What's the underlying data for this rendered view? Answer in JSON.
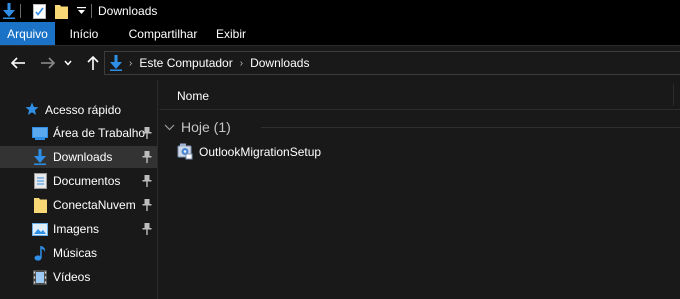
{
  "titlebar": {
    "title": "Downloads",
    "icons": [
      "downloads-folder-icon",
      "properties-icon",
      "new-folder-icon",
      "customize-toolbar-icon"
    ]
  },
  "ribbon": {
    "tabs": [
      {
        "label": "Arquivo",
        "active": true
      },
      {
        "label": "Início",
        "active": false
      },
      {
        "label": "Compartilhar",
        "active": false
      },
      {
        "label": "Exibir",
        "active": false
      }
    ]
  },
  "address": {
    "icons": [
      "back-arrow-icon",
      "forward-arrow-icon",
      "recent-locations-chevron-icon",
      "up-arrow-icon"
    ],
    "breadcrumbs": [
      "Este Computador",
      "Downloads"
    ]
  },
  "sidebar": {
    "quick_access": "Acesso rápido",
    "items": [
      {
        "label": "Área de Trabalho",
        "icon": "desktop-icon",
        "pinned": true,
        "selected": false
      },
      {
        "label": "Downloads",
        "icon": "downloads-icon",
        "pinned": true,
        "selected": true
      },
      {
        "label": "Documentos",
        "icon": "documents-icon",
        "pinned": true,
        "selected": false
      },
      {
        "label": "ConectaNuvem",
        "icon": "folder-icon",
        "pinned": true,
        "selected": false
      },
      {
        "label": "Imagens",
        "icon": "pictures-icon",
        "pinned": true,
        "selected": false
      },
      {
        "label": "Músicas",
        "icon": "music-icon",
        "pinned": false,
        "selected": false
      },
      {
        "label": "Vídeos",
        "icon": "videos-icon",
        "pinned": false,
        "selected": false
      }
    ]
  },
  "content": {
    "column_name": "Nome",
    "group_label": "Hoje (1)",
    "files": [
      {
        "name": "OutlookMigrationSetup",
        "icon": "installer-icon"
      }
    ]
  },
  "colors": {
    "accent": "#1a73c7",
    "background": "#191919",
    "titlebar": "#000000",
    "selection": "#333333",
    "folder": "#f8d775",
    "download_blue": "#2f8ee6"
  }
}
